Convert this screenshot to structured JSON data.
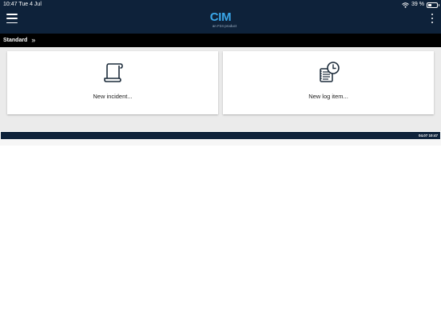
{
  "status_bar": {
    "time_date": "10:47  Tue 4 Jul",
    "battery_text": "39 %",
    "battery_level": 0.39,
    "icons": [
      "wifi-icon",
      "battery-icon"
    ]
  },
  "app_bar": {
    "title": "CIM",
    "subtitle": "an F24 product",
    "left_icon": "menu-icon",
    "right_icon": "more-vertical-icon"
  },
  "breadcrumb": {
    "label": "Standard",
    "chevron": "»"
  },
  "tiles": [
    {
      "label": "New incident...",
      "icon": "scroll-icon"
    },
    {
      "label": "New log item...",
      "icon": "log-clock-icon"
    }
  ],
  "footer": {
    "timestamp": "04.07 10:47"
  },
  "colors": {
    "header_bg": "#0e223a",
    "brand_blue": "#3aa6e8",
    "breadcrumb_bg": "#000000",
    "content_bg": "#ebebeb",
    "icon_color": "#1c2b3a"
  }
}
